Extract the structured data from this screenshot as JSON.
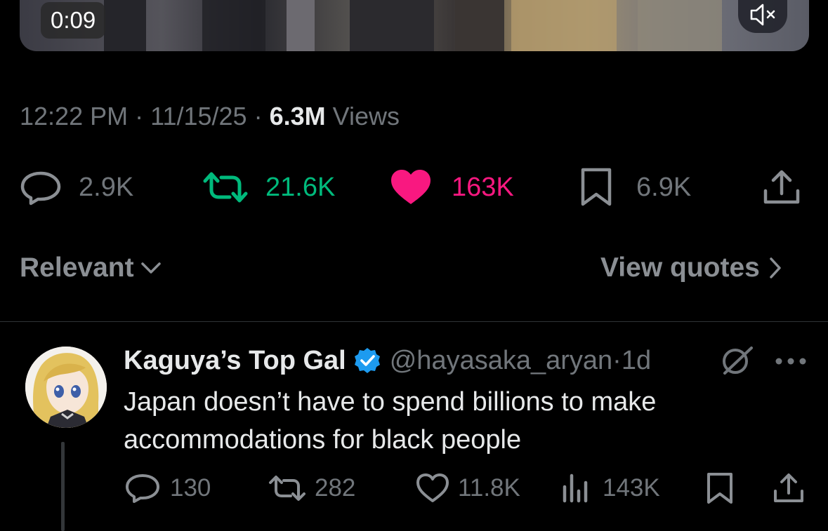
{
  "video": {
    "timestamp": "0:09",
    "mute_icon": "speaker-muted-icon"
  },
  "tweet_meta": {
    "time": "12:22 PM",
    "sep1": " · ",
    "date": "11/15/25",
    "sep2": " · ",
    "views_count": "6.3M",
    "views_label": " Views"
  },
  "actions": {
    "replies": "2.9K",
    "reposts": "21.6K",
    "likes": "163K",
    "bookmarks": "6.9K"
  },
  "sort": {
    "label": "Relevant",
    "view_quotes": "View quotes"
  },
  "reply": {
    "name": "Kaguya’s Top Gal",
    "handle": "@hayasaka_aryan",
    "sep": " · ",
    "time": "1d",
    "text": "Japan doesn’t have to spend billions to make accommodations for black people",
    "replies": "130",
    "reposts": "282",
    "likes": "11.8K",
    "views": "143K"
  },
  "colors": {
    "background": "#000000",
    "secondary_text": "#71767b",
    "repost_active": "#00ba7c",
    "like_active": "#f91880",
    "verified": "#1d9bf0"
  }
}
